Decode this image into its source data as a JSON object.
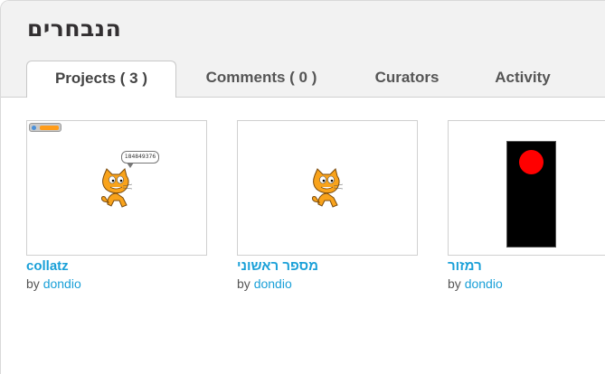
{
  "page": {
    "title": "הנבחרים"
  },
  "tabs": [
    {
      "label": "Projects ( 3 )",
      "active": true
    },
    {
      "label": "Comments ( 0 )",
      "active": false
    },
    {
      "label": "Curators",
      "active": false
    },
    {
      "label": "Activity",
      "active": false
    }
  ],
  "projects": [
    {
      "title": "collatz",
      "by": "by",
      "author": "dondio",
      "bubble_text": "184849376"
    },
    {
      "title": "מספר ראשוני",
      "by": "by",
      "author": "dondio"
    },
    {
      "title": "רמזור",
      "by": "by",
      "author": "dondio"
    }
  ],
  "colors": {
    "link": "#1aa0d8",
    "header_bg": "#f2f2f2",
    "light_red": "#ff0000"
  }
}
